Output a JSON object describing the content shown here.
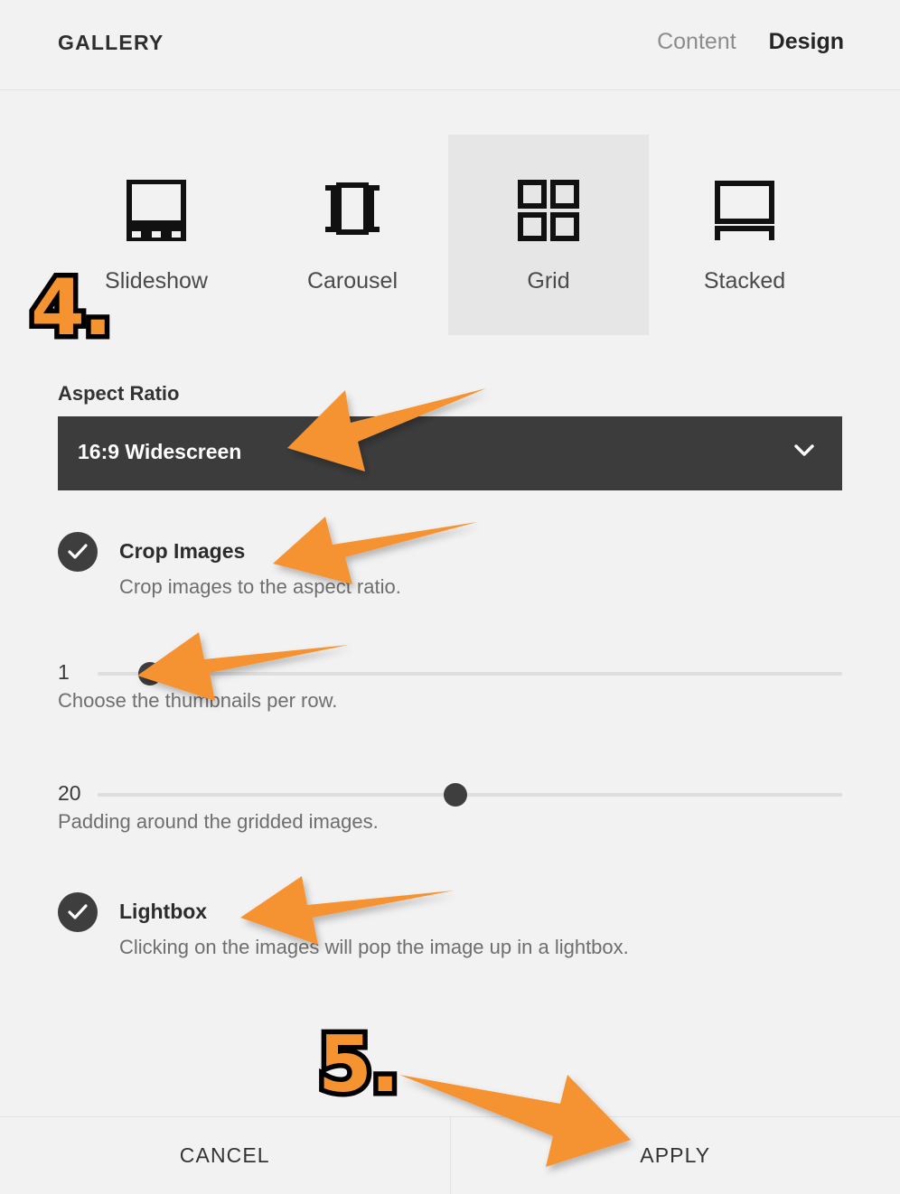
{
  "header": {
    "title": "GALLERY",
    "tabs": [
      {
        "label": "Content",
        "active": false
      },
      {
        "label": "Design",
        "active": true
      }
    ]
  },
  "layouts": {
    "options": [
      {
        "label": "Slideshow",
        "icon": "slideshow-icon",
        "selected": false
      },
      {
        "label": "Carousel",
        "icon": "carousel-icon",
        "selected": false
      },
      {
        "label": "Grid",
        "icon": "grid-icon",
        "selected": true
      },
      {
        "label": "Stacked",
        "icon": "stacked-icon",
        "selected": false
      }
    ]
  },
  "aspect_ratio": {
    "label": "Aspect Ratio",
    "value": "16:9 Widescreen",
    "caret": "chevron-down-icon"
  },
  "crop_images": {
    "title": "Crop Images",
    "description": "Crop images to the aspect ratio.",
    "checked": true
  },
  "thumbnails_slider": {
    "value": "1",
    "description": "Choose the thumbnails per row.",
    "percent": 7
  },
  "padding_slider": {
    "value": "20",
    "description": "Padding around the gridded images.",
    "percent": 48
  },
  "lightbox": {
    "title": "Lightbox",
    "description": "Clicking on the images will pop the image up in a lightbox.",
    "checked": true
  },
  "footer": {
    "cancel_label": "CANCEL",
    "apply_label": "APPLY"
  },
  "annotations": {
    "step4": "4.",
    "step5": "5.",
    "arrow_color": "#F59331",
    "badge_fill": "#F59331",
    "badge_stroke": "#000000"
  },
  "colors": {
    "page_background": "#F2F2F2",
    "selected_tile": "#E6E6E6",
    "select_bar": "#3C3C3C",
    "control_dark": "#3E3E3E",
    "accent_orange": "#F59331",
    "muted_text": "#6E6E6E"
  }
}
